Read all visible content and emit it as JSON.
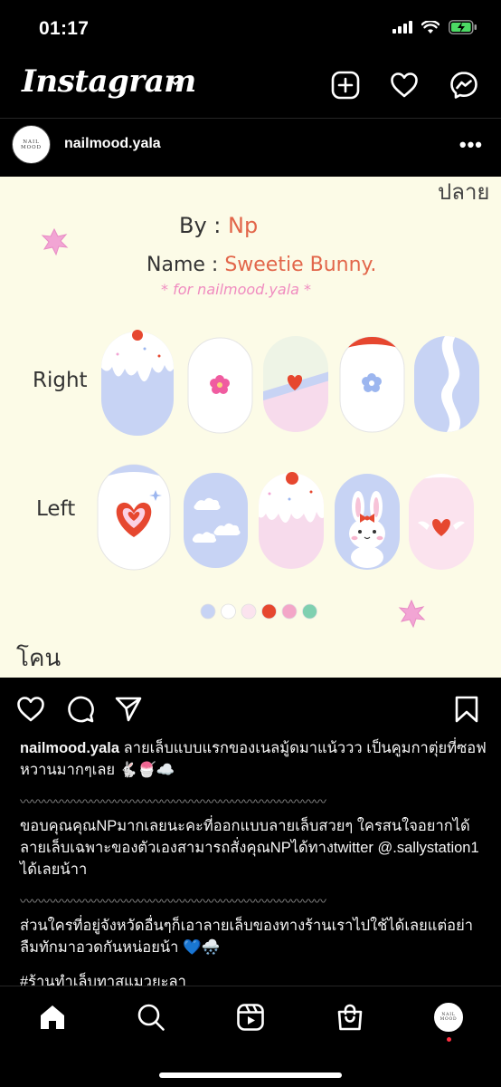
{
  "status_bar": {
    "time": "01:17"
  },
  "header": {
    "logo": "Instagram"
  },
  "post": {
    "username": "nailmood.yala",
    "avatar_text": [
      "NAIL",
      "MOOD"
    ],
    "image": {
      "top_right_label": "ปลาย",
      "bottom_left_label": "โคน",
      "by_label": "By : ",
      "by_value": "Np",
      "name_label": "Name : ",
      "name_value": "Sweetie Bunny.",
      "for_label": "* for nailmood.yala *",
      "row_right": "Right",
      "row_left": "Left",
      "palette": [
        "#c7d3f4",
        "#ffffff",
        "#fbe3ee",
        "#e6472f",
        "#f3a6c8",
        "#7fd0b0"
      ]
    },
    "caption": {
      "username": "nailmood.yala",
      "para1": " ลายเล็บแบบแรกของเนลมู้ดมาแน้ววว เป็นคูมกาตุ่ยที่ซอฟหวานมากๆเลย 🐇🍧☁️",
      "wave": "〰〰〰〰〰〰〰〰〰〰〰〰〰〰〰〰〰〰〰〰〰〰〰〰〰〰",
      "para2": "ขอบคุณคุณNPมากเลยนะคะที่ออกแบบลายเล็บสวยๆ ใครสนใจอยากได้ลายเล็บเฉพาะของตัวเองสามารถสั่งคุณNPได้ทางtwitter @.sallystation1 ได้เลยน้าา",
      "para3": "ส่วนใครที่อยู่จังหวัดอื่นๆก็เอาลายเล็บของทางร้านเราไปใช้ได้เลยแต่อย่าลืมทักมาอวดกันหน่อยน้า 💙🌨️",
      "hashtag": "#ร้านทำเล็บทาสแมวยะลา"
    }
  },
  "colors": {
    "accent_red": "#ff3040",
    "nail_blue": "#c7d3f4",
    "nail_pink": "#fbe3ee",
    "nail_red": "#e6472f",
    "image_bg": "#fcfbe7"
  }
}
